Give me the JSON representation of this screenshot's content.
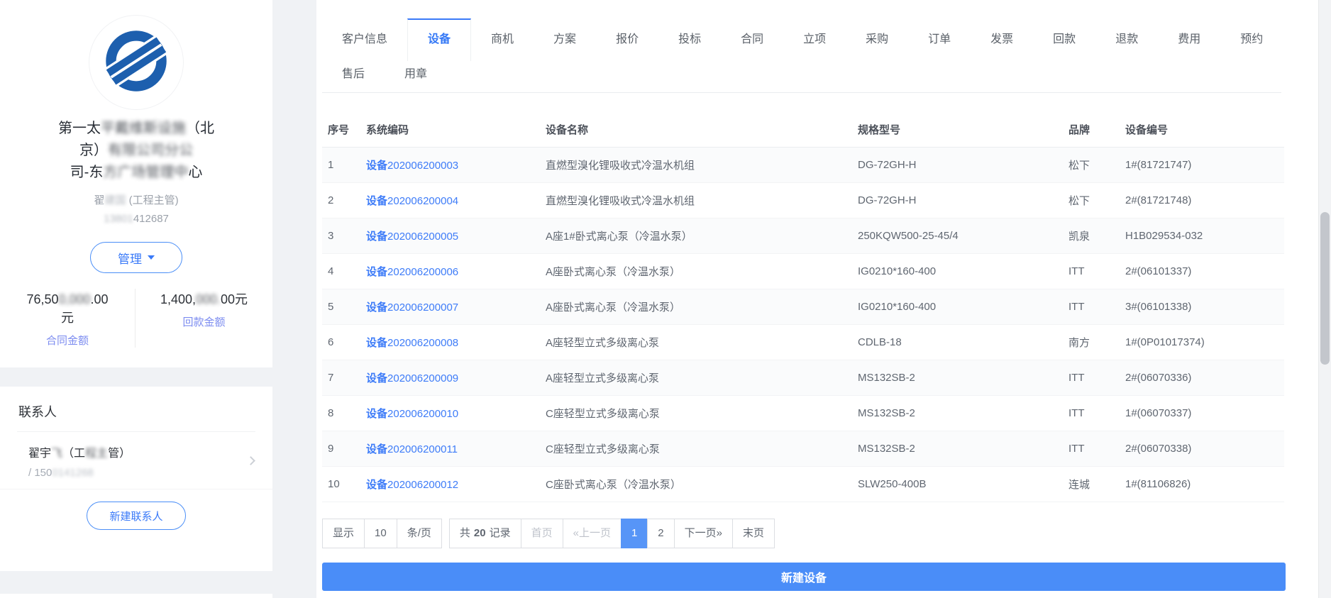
{
  "colors": {
    "accent": "#3a7af8",
    "primary_button_bg": "#4a8df8",
    "active_page_bg": "#5795f7",
    "link": "#3e7cf8",
    "logo_blue": "#1d5fae"
  },
  "sidebar": {
    "company_name": {
      "line1_pre": "第一太",
      "line1_blur": "平戴维斯设施",
      "line1_post": "（北",
      "line2_pre": "京）",
      "line2_blur": "有限公司分公",
      "line3_pre": "司-东",
      "line3_blur": "方广场管理中",
      "line3_post": "心"
    },
    "owner": {
      "name_pre": "翟",
      "name_blur": "建国",
      "name_post": " (工程主管)",
      "phone_blur": "13801",
      "phone_post": "412687"
    },
    "manage_button": {
      "label": "管理"
    },
    "stats": {
      "contract": {
        "value_pre": "76,50",
        "value_blur": "0,000",
        "value_post": ".00",
        "unit": "元",
        "label": "合同金额"
      },
      "received": {
        "value_pre": "1,400,",
        "value_blur": "000.",
        "value_post": "00元",
        "label": "回款金额"
      }
    },
    "contacts": {
      "title": "联系人",
      "item": {
        "name_pre": "翟宇",
        "name_blur": "飞",
        "name_mid": "（工",
        "name_blur2": "程主",
        "name_post": "管）",
        "phone_pre": "/ 150",
        "phone_blur": "0141268"
      },
      "new_contact_label": "新建联系人"
    }
  },
  "tabs": {
    "row1": [
      {
        "label": "客户信息",
        "active": false
      },
      {
        "label": "设备",
        "active": true
      },
      {
        "label": "商机",
        "active": false
      },
      {
        "label": "方案",
        "active": false
      },
      {
        "label": "报价",
        "active": false
      },
      {
        "label": "投标",
        "active": false
      },
      {
        "label": "合同",
        "active": false
      },
      {
        "label": "立项",
        "active": false
      },
      {
        "label": "采购",
        "active": false
      },
      {
        "label": "订单",
        "active": false
      },
      {
        "label": "发票",
        "active": false
      },
      {
        "label": "回款",
        "active": false
      },
      {
        "label": "退款",
        "active": false
      },
      {
        "label": "费用",
        "active": false
      },
      {
        "label": "预约",
        "active": false
      }
    ],
    "row2": [
      {
        "label": "售后",
        "active": false
      },
      {
        "label": "用章",
        "active": false
      }
    ]
  },
  "table": {
    "headers": [
      "序号",
      "系统编码",
      "设备名称",
      "规格型号",
      "品牌",
      "设备编号"
    ],
    "rows": [
      {
        "index": "1",
        "code": "设备202006200003",
        "name": "直燃型溴化锂吸收式冷温水机组",
        "spec": "DG-72GH-H",
        "brand": "松下",
        "device_no": "1#(81721747)"
      },
      {
        "index": "2",
        "code": "设备202006200004",
        "name": "直燃型溴化锂吸收式冷温水机组",
        "spec": "DG-72GH-H",
        "brand": "松下",
        "device_no": "2#(81721748)"
      },
      {
        "index": "3",
        "code": "设备202006200005",
        "name": "A座1#卧式离心泵（冷温水泵）",
        "spec": "250KQW500-25-45/4",
        "brand": "凯泉",
        "device_no": "H1B029534-032"
      },
      {
        "index": "4",
        "code": "设备202006200006",
        "name": "A座卧式离心泵（冷温水泵）",
        "spec": "IG0210*160-400",
        "brand": "ITT",
        "device_no": "2#(06101337)"
      },
      {
        "index": "5",
        "code": "设备202006200007",
        "name": "A座卧式离心泵（冷温水泵）",
        "spec": "IG0210*160-400",
        "brand": "ITT",
        "device_no": "3#(06101338)"
      },
      {
        "index": "6",
        "code": "设备202006200008",
        "name": "A座轻型立式多级离心泵",
        "spec": "CDLB-18",
        "brand": "南方",
        "device_no": "1#(0P01017374)"
      },
      {
        "index": "7",
        "code": "设备202006200009",
        "name": "A座轻型立式多级离心泵",
        "spec": "MS132SB-2",
        "brand": "ITT",
        "device_no": "2#(06070336)"
      },
      {
        "index": "8",
        "code": "设备202006200010",
        "name": "C座轻型立式多级离心泵",
        "spec": "MS132SB-2",
        "brand": "ITT",
        "device_no": "1#(06070337)"
      },
      {
        "index": "9",
        "code": "设备202006200011",
        "name": "C座轻型立式多级离心泵",
        "spec": "MS132SB-2",
        "brand": "ITT",
        "device_no": "2#(06070338)"
      },
      {
        "index": "10",
        "code": "设备202006200012",
        "name": "C座卧式离心泵（冷温水泵）",
        "spec": "SLW250-400B",
        "brand": "连城",
        "device_no": "1#(81106826)"
      }
    ]
  },
  "pagination": {
    "display_label": "显示",
    "page_size": "10",
    "per_page_label": "条/页",
    "total_pre": "共",
    "total_count": "20",
    "total_post": "记录",
    "controls": [
      {
        "id": "first-page",
        "label": "首页",
        "disabled": true,
        "active": false
      },
      {
        "id": "prev-page",
        "label": "«上一页",
        "disabled": true,
        "active": false
      },
      {
        "id": "page-1",
        "label": "1",
        "disabled": false,
        "active": true
      },
      {
        "id": "page-2",
        "label": "2",
        "disabled": false,
        "active": false
      },
      {
        "id": "next-page",
        "label": "下一页»",
        "disabled": false,
        "active": false
      },
      {
        "id": "last-page",
        "label": "末页",
        "disabled": false,
        "active": false
      }
    ]
  },
  "new_device_button_label": "新建设备"
}
